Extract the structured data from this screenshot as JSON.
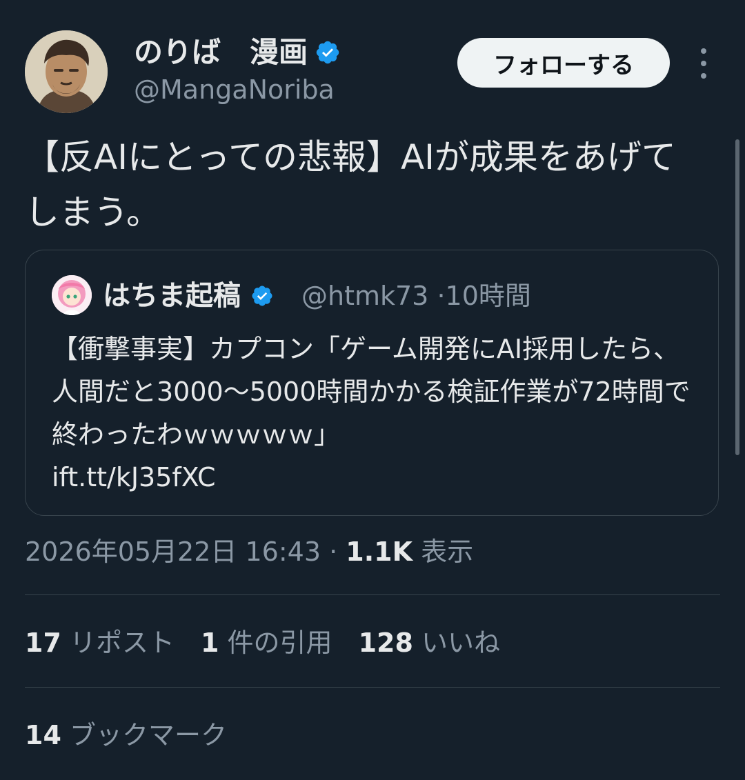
{
  "author": {
    "display_name": "のりば　漫画",
    "handle": "@MangaNoriba",
    "verified_icon": "verified-badge-icon",
    "avatar_icon": "avatar"
  },
  "actions": {
    "follow_label": "フォローする",
    "more_icon": "more-options-icon"
  },
  "tweet": {
    "text": "【反AIにとっての悲報】AIが成果をあげてしまう。"
  },
  "quote": {
    "display_name": "はちま起稿",
    "handle": "@htmk73",
    "separator": "·",
    "time": "10時間",
    "text": "【衝撃事実】カプコン「ゲーム開発にAI採用したら、人間だと3000〜5000時間かかる検証作業が72時間で終わったわｗｗｗｗｗ」",
    "link": "ift.tt/kJ35fXC"
  },
  "meta": {
    "timestamp": "2026年05月22日 16:43",
    "separator": "·",
    "views_count": "1.1K",
    "views_label": "表示"
  },
  "stats": {
    "reposts_count": "17",
    "reposts_label": "リポスト",
    "quotes_count": "1",
    "quotes_label": "件の引用",
    "likes_count": "128",
    "likes_label": "いいね",
    "bookmarks_count": "14",
    "bookmarks_label": "ブックマーク"
  },
  "colors": {
    "background": "#15202b",
    "text_primary": "#e7e9ea",
    "text_secondary": "#8b98a5",
    "border": "#38444d",
    "verified_blue": "#1d9bf0",
    "follow_button_bg": "#eff3f4"
  }
}
